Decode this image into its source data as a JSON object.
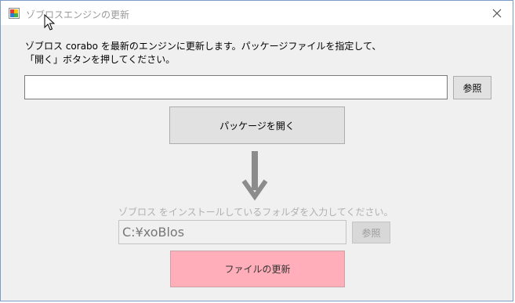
{
  "window": {
    "title": "ゾブロスエンジンの更新"
  },
  "instructions": {
    "line1": "ゾブロス corabo を最新のエンジンに更新します。パッケージファイルを指定して、",
    "line2": "「開く」ボタンを押してください。"
  },
  "package": {
    "path_value": "",
    "browse_label": "参照",
    "open_label": "パッケージを開く"
  },
  "install": {
    "folder_label": "ゾブロス をインストールしているフォルダを入力してください。",
    "folder_value": "C:¥xoBlos",
    "browse_label": "参照",
    "update_label": "ファイルの更新"
  },
  "icons": [
    "app-icon",
    "close-icon",
    "mouse-cursor-icon",
    "down-arrow-icon"
  ],
  "colors": {
    "update_button": "#ffaeba",
    "window_border": "#7a9cc6"
  }
}
